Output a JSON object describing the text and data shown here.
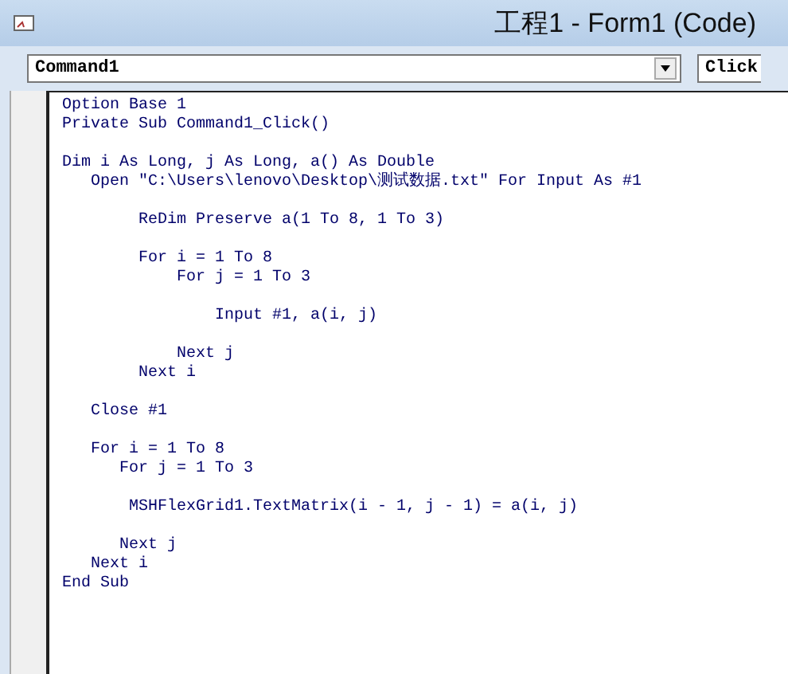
{
  "window": {
    "title": "工程1 - Form1 (Code)"
  },
  "object_combo": {
    "value": "Command1"
  },
  "procedure_combo": {
    "value": "Click"
  },
  "code_lines": [
    {
      "kind": "code",
      "text": "Option Base 1"
    },
    {
      "kind": "code",
      "text": "Private Sub Command1_Click()"
    },
    {
      "kind": "blank"
    },
    {
      "kind": "code",
      "text": "Dim i As Long, j As Long, a() As Double"
    },
    {
      "kind": "code",
      "text": "   Open \"C:\\Users\\lenovo\\Desktop\\测试数据.txt\" For Input As #1"
    },
    {
      "kind": "blank"
    },
    {
      "kind": "code",
      "text": "        ReDim Preserve a(1 To 8, 1 To 3)"
    },
    {
      "kind": "blank"
    },
    {
      "kind": "code",
      "text": "        For i = 1 To 8"
    },
    {
      "kind": "code",
      "text": "            For j = 1 To 3"
    },
    {
      "kind": "blank"
    },
    {
      "kind": "code",
      "text": "                Input #1, a(i, j)"
    },
    {
      "kind": "blank"
    },
    {
      "kind": "code",
      "text": "            Next j"
    },
    {
      "kind": "code",
      "text": "        Next i"
    },
    {
      "kind": "blank"
    },
    {
      "kind": "code",
      "text": "   Close #1"
    },
    {
      "kind": "blank"
    },
    {
      "kind": "code",
      "text": "   For i = 1 To 8"
    },
    {
      "kind": "code",
      "text": "      For j = 1 To 3"
    },
    {
      "kind": "blank"
    },
    {
      "kind": "code",
      "text": "       MSHFlexGrid1.TextMatrix(i - 1, j - 1) = a(i, j)"
    },
    {
      "kind": "blank"
    },
    {
      "kind": "code",
      "text": "      Next j"
    },
    {
      "kind": "code",
      "text": "   Next i"
    },
    {
      "kind": "code",
      "text": "End Sub"
    }
  ]
}
